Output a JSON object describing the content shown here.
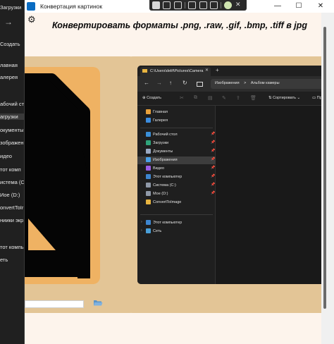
{
  "background_explorer": {
    "items": [
      {
        "label": "Загрузки",
        "top": 0
      },
      {
        "label": "Создать",
        "top": 0
      },
      {
        "label": "лавная",
        "top": 0
      },
      {
        "label": "алерея",
        "top": 0
      },
      {
        "label": "абочий ст",
        "top": 0
      },
      {
        "label": "агрузки",
        "top": 0
      },
      {
        "label": "окументы",
        "top": 0
      },
      {
        "label": "зображен",
        "top": 0
      },
      {
        "label": "идео",
        "top": 0
      },
      {
        "label": "тот комп",
        "top": 0
      },
      {
        "label": "истема (С",
        "top": 0
      },
      {
        "label": "Иое (D:)",
        "top": 0
      },
      {
        "label": "onvertToIr",
        "top": 0
      },
      {
        "label": "ниики экр",
        "top": 0
      },
      {
        "label": "тот компью",
        "top": 0
      },
      {
        "label": "еть",
        "top": 0
      }
    ]
  },
  "window": {
    "title": "Конвертация картинок",
    "minimize": "—",
    "maximize": "☐",
    "close": "✕"
  },
  "headline": "Конвертировать форматы .png, .raw, .gif, .bmp, .tiff в jpg",
  "settings_icon": "⚙",
  "inner_explorer": {
    "tab_title": "C:\\Users\\delif\\Pictures\\Camera",
    "address_parts": [
      "Изображения",
      ">",
      "Альбом камеры"
    ],
    "toolbar": {
      "create": "Создать",
      "sort": "Сортировать",
      "view": "Просм"
    },
    "nav": [
      {
        "label": "Главная",
        "color": "#e9a13b",
        "pin": false
      },
      {
        "label": "Галерея",
        "color": "#3c8de0",
        "pin": false
      },
      {
        "label": "Рабочий стол",
        "color": "#3a8fd8",
        "pin": true
      },
      {
        "label": "Загрузки",
        "color": "#2fa37a",
        "pin": true
      },
      {
        "label": "Документы",
        "color": "#9aa9c2",
        "pin": true
      },
      {
        "label": "Изображения",
        "color": "#4aa0e6",
        "pin": true,
        "selected": true
      },
      {
        "label": "Видео",
        "color": "#9b5de5",
        "pin": true
      },
      {
        "label": "Этот компьютер",
        "color": "#3d86d0",
        "pin": true
      },
      {
        "label": "Система (C:)",
        "color": "#8f99a8",
        "pin": true
      },
      {
        "label": "Мое (D:)",
        "color": "#8f99a8",
        "pin": true
      },
      {
        "label": "ConvertToImage",
        "color": "#e8b440",
        "pin": false
      },
      {
        "label": "Этот компьютер",
        "color": "#3d86d0",
        "pin": false,
        "expand": true
      },
      {
        "label": "Сеть",
        "color": "#4a9fd8",
        "pin": false,
        "expand": true
      }
    ]
  },
  "colors": {
    "window_bg": "#fdf4ec",
    "card_bg": "#e3c596",
    "icon_orange": "#efb263",
    "explorer_dark": "#1b1b1b"
  }
}
